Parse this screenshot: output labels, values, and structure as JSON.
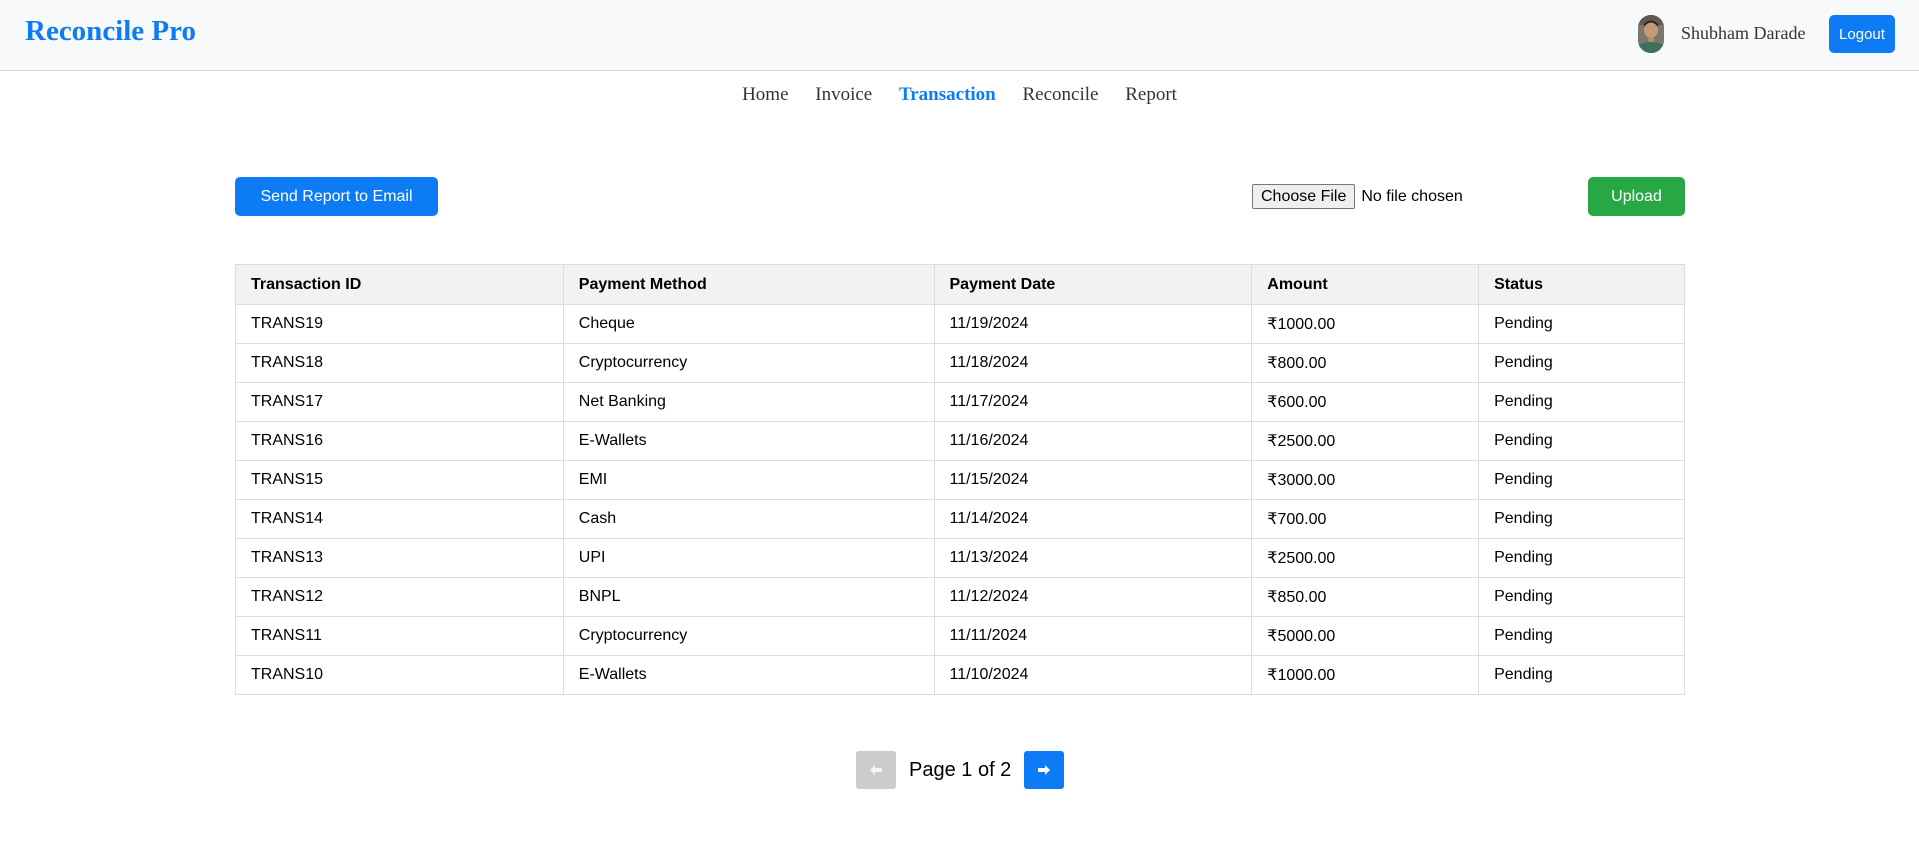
{
  "app": {
    "brand": "Reconcile Pro"
  },
  "user": {
    "name": "Shubham Darade",
    "logout_label": "Logout"
  },
  "nav": {
    "items": [
      {
        "label": "Home"
      },
      {
        "label": "Invoice"
      },
      {
        "label": "Transaction",
        "active": true
      },
      {
        "label": "Reconcile"
      },
      {
        "label": "Report"
      }
    ]
  },
  "actions": {
    "send_report_label": "Send Report to Email",
    "choose_file_label": "Choose File",
    "file_status": "No file chosen",
    "upload_label": "Upload"
  },
  "table": {
    "headers": [
      "Transaction ID",
      "Payment Method",
      "Payment Date",
      "Amount",
      "Status"
    ],
    "rows": [
      [
        "TRANS19",
        "Cheque",
        "11/19/2024",
        "₹1000.00",
        "Pending"
      ],
      [
        "TRANS18",
        "Cryptocurrency",
        "11/18/2024",
        "₹800.00",
        "Pending"
      ],
      [
        "TRANS17",
        "Net Banking",
        "11/17/2024",
        "₹600.00",
        "Pending"
      ],
      [
        "TRANS16",
        "E-Wallets",
        "11/16/2024",
        "₹2500.00",
        "Pending"
      ],
      [
        "TRANS15",
        "EMI",
        "11/15/2024",
        "₹3000.00",
        "Pending"
      ],
      [
        "TRANS14",
        "Cash",
        "11/14/2024",
        "₹700.00",
        "Pending"
      ],
      [
        "TRANS13",
        "UPI",
        "11/13/2024",
        "₹2500.00",
        "Pending"
      ],
      [
        "TRANS12",
        "BNPL",
        "11/12/2024",
        "₹850.00",
        "Pending"
      ],
      [
        "TRANS11",
        "Cryptocurrency",
        "11/11/2024",
        "₹5000.00",
        "Pending"
      ],
      [
        "TRANS10",
        "E-Wallets",
        "11/10/2024",
        "₹1000.00",
        "Pending"
      ]
    ]
  },
  "pagination": {
    "label": "Page 1 of 2",
    "prev_icon": "arrow-left-icon",
    "next_icon": "arrow-right-icon",
    "prev_disabled": true
  },
  "colors": {
    "brand": "#0d7bf3",
    "primary": "#0d7bf3",
    "success": "#28a745",
    "disabled": "#cccccc"
  }
}
